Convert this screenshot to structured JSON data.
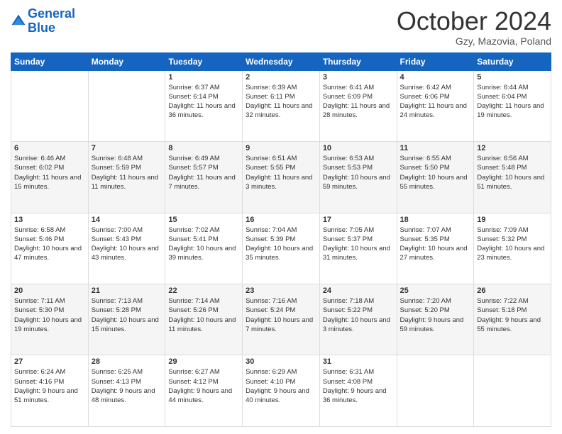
{
  "header": {
    "logo_line1": "General",
    "logo_line2": "Blue",
    "title": "October 2024",
    "subtitle": "Gzy, Mazovia, Poland"
  },
  "days_of_week": [
    "Sunday",
    "Monday",
    "Tuesday",
    "Wednesday",
    "Thursday",
    "Friday",
    "Saturday"
  ],
  "weeks": [
    [
      {
        "day": "",
        "content": ""
      },
      {
        "day": "",
        "content": ""
      },
      {
        "day": "1",
        "content": "Sunrise: 6:37 AM\nSunset: 6:14 PM\nDaylight: 11 hours and 36 minutes."
      },
      {
        "day": "2",
        "content": "Sunrise: 6:39 AM\nSunset: 6:11 PM\nDaylight: 11 hours and 32 minutes."
      },
      {
        "day": "3",
        "content": "Sunrise: 6:41 AM\nSunset: 6:09 PM\nDaylight: 11 hours and 28 minutes."
      },
      {
        "day": "4",
        "content": "Sunrise: 6:42 AM\nSunset: 6:06 PM\nDaylight: 11 hours and 24 minutes."
      },
      {
        "day": "5",
        "content": "Sunrise: 6:44 AM\nSunset: 6:04 PM\nDaylight: 11 hours and 19 minutes."
      }
    ],
    [
      {
        "day": "6",
        "content": "Sunrise: 6:46 AM\nSunset: 6:02 PM\nDaylight: 11 hours and 15 minutes."
      },
      {
        "day": "7",
        "content": "Sunrise: 6:48 AM\nSunset: 5:59 PM\nDaylight: 11 hours and 11 minutes."
      },
      {
        "day": "8",
        "content": "Sunrise: 6:49 AM\nSunset: 5:57 PM\nDaylight: 11 hours and 7 minutes."
      },
      {
        "day": "9",
        "content": "Sunrise: 6:51 AM\nSunset: 5:55 PM\nDaylight: 11 hours and 3 minutes."
      },
      {
        "day": "10",
        "content": "Sunrise: 6:53 AM\nSunset: 5:53 PM\nDaylight: 10 hours and 59 minutes."
      },
      {
        "day": "11",
        "content": "Sunrise: 6:55 AM\nSunset: 5:50 PM\nDaylight: 10 hours and 55 minutes."
      },
      {
        "day": "12",
        "content": "Sunrise: 6:56 AM\nSunset: 5:48 PM\nDaylight: 10 hours and 51 minutes."
      }
    ],
    [
      {
        "day": "13",
        "content": "Sunrise: 6:58 AM\nSunset: 5:46 PM\nDaylight: 10 hours and 47 minutes."
      },
      {
        "day": "14",
        "content": "Sunrise: 7:00 AM\nSunset: 5:43 PM\nDaylight: 10 hours and 43 minutes."
      },
      {
        "day": "15",
        "content": "Sunrise: 7:02 AM\nSunset: 5:41 PM\nDaylight: 10 hours and 39 minutes."
      },
      {
        "day": "16",
        "content": "Sunrise: 7:04 AM\nSunset: 5:39 PM\nDaylight: 10 hours and 35 minutes."
      },
      {
        "day": "17",
        "content": "Sunrise: 7:05 AM\nSunset: 5:37 PM\nDaylight: 10 hours and 31 minutes."
      },
      {
        "day": "18",
        "content": "Sunrise: 7:07 AM\nSunset: 5:35 PM\nDaylight: 10 hours and 27 minutes."
      },
      {
        "day": "19",
        "content": "Sunrise: 7:09 AM\nSunset: 5:32 PM\nDaylight: 10 hours and 23 minutes."
      }
    ],
    [
      {
        "day": "20",
        "content": "Sunrise: 7:11 AM\nSunset: 5:30 PM\nDaylight: 10 hours and 19 minutes."
      },
      {
        "day": "21",
        "content": "Sunrise: 7:13 AM\nSunset: 5:28 PM\nDaylight: 10 hours and 15 minutes."
      },
      {
        "day": "22",
        "content": "Sunrise: 7:14 AM\nSunset: 5:26 PM\nDaylight: 10 hours and 11 minutes."
      },
      {
        "day": "23",
        "content": "Sunrise: 7:16 AM\nSunset: 5:24 PM\nDaylight: 10 hours and 7 minutes."
      },
      {
        "day": "24",
        "content": "Sunrise: 7:18 AM\nSunset: 5:22 PM\nDaylight: 10 hours and 3 minutes."
      },
      {
        "day": "25",
        "content": "Sunrise: 7:20 AM\nSunset: 5:20 PM\nDaylight: 9 hours and 59 minutes."
      },
      {
        "day": "26",
        "content": "Sunrise: 7:22 AM\nSunset: 5:18 PM\nDaylight: 9 hours and 55 minutes."
      }
    ],
    [
      {
        "day": "27",
        "content": "Sunrise: 6:24 AM\nSunset: 4:16 PM\nDaylight: 9 hours and 51 minutes."
      },
      {
        "day": "28",
        "content": "Sunrise: 6:25 AM\nSunset: 4:13 PM\nDaylight: 9 hours and 48 minutes."
      },
      {
        "day": "29",
        "content": "Sunrise: 6:27 AM\nSunset: 4:12 PM\nDaylight: 9 hours and 44 minutes."
      },
      {
        "day": "30",
        "content": "Sunrise: 6:29 AM\nSunset: 4:10 PM\nDaylight: 9 hours and 40 minutes."
      },
      {
        "day": "31",
        "content": "Sunrise: 6:31 AM\nSunset: 4:08 PM\nDaylight: 9 hours and 36 minutes."
      },
      {
        "day": "",
        "content": ""
      },
      {
        "day": "",
        "content": ""
      }
    ]
  ]
}
